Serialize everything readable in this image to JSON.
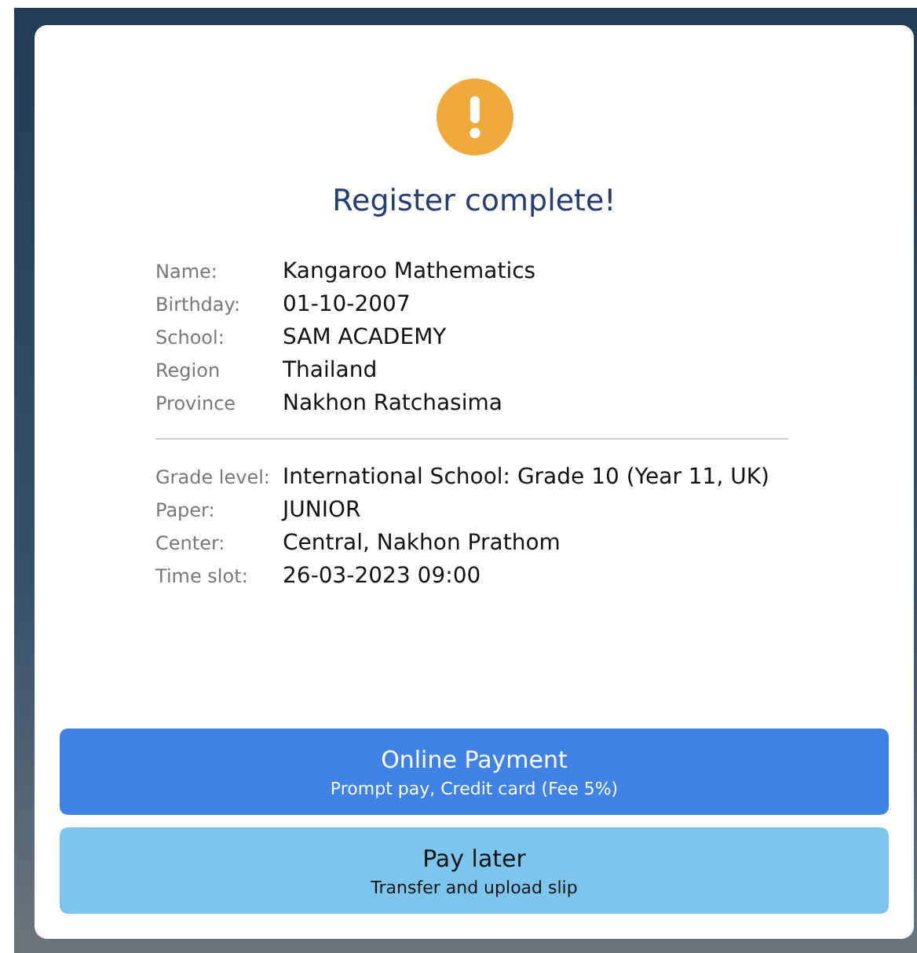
{
  "dialog": {
    "title": "Register complete!",
    "student": [
      {
        "label": "Name:",
        "value": "Kangaroo Mathematics"
      },
      {
        "label": "Birthday:",
        "value": "01-10-2007"
      },
      {
        "label": "School:",
        "value": "SAM ACADEMY"
      },
      {
        "label": "Region",
        "value": "Thailand"
      },
      {
        "label": "Province",
        "value": "Nakhon Ratchasima"
      }
    ],
    "exam": [
      {
        "label": "Grade level:",
        "value": "International School: Grade 10 (Year 11, UK)"
      },
      {
        "label": "Paper:",
        "value": "JUNIOR"
      },
      {
        "label": "Center:",
        "value": "Central, Nakhon Prathom"
      },
      {
        "label": "Time slot:",
        "value": "26-03-2023 09:00"
      }
    ],
    "buttons": [
      {
        "kind": "primary",
        "title": "Online Payment",
        "subtitle": "Prompt pay, Credit card (Fee 5%)"
      },
      {
        "kind": "secondary",
        "title": "Pay later",
        "subtitle": "Transfer and upload slip"
      }
    ]
  }
}
